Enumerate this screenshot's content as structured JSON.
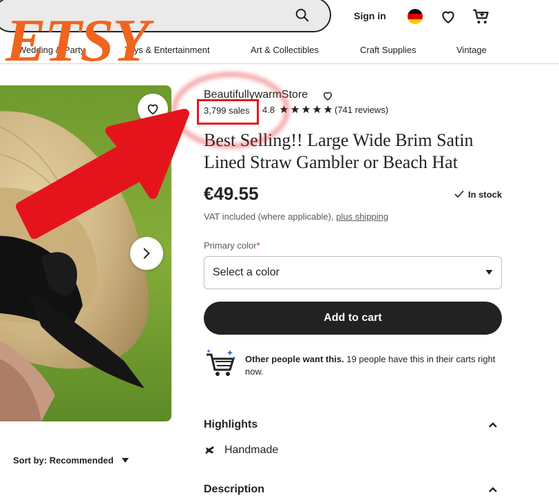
{
  "header": {
    "logo": "ETSY",
    "sign_in": "Sign in",
    "search_icon": "search-icon",
    "flag_icon": "germany-flag-icon",
    "favorites_icon": "heart-icon",
    "cart_icon": "cart-icon"
  },
  "categories": [
    "Wedding & Party",
    "Toys & Entertainment",
    "Art & Collectibles",
    "Craft Supplies",
    "Vintage"
  ],
  "product": {
    "shop_name": "BeautifullywarmStore",
    "sales": "3,799 sales",
    "rating": "4.8",
    "rating_stars": 5,
    "reviews": "(741 reviews)",
    "title": "Best Selling!! Large Wide Brim Satin Lined Straw Gambler or Beach Hat",
    "price": "€49.55",
    "stock": "In stock",
    "vat_text": "VAT included (where applicable),",
    "shipping_link": "plus shipping",
    "color_label": "Primary color",
    "required_mark": "*",
    "color_placeholder": "Select a color",
    "add_to_cart": "Add to cart",
    "others_bold": "Other people want this.",
    "others_rest": " 19 people have this in their carts right now.",
    "highlights": "Highlights",
    "handmade": "Handmade",
    "description": "Description"
  },
  "sort": {
    "label": "Sort by:",
    "value": "Recommended"
  },
  "colors": {
    "brand": "#f1641e",
    "annotation": "#e5141c",
    "star": "#222222"
  }
}
